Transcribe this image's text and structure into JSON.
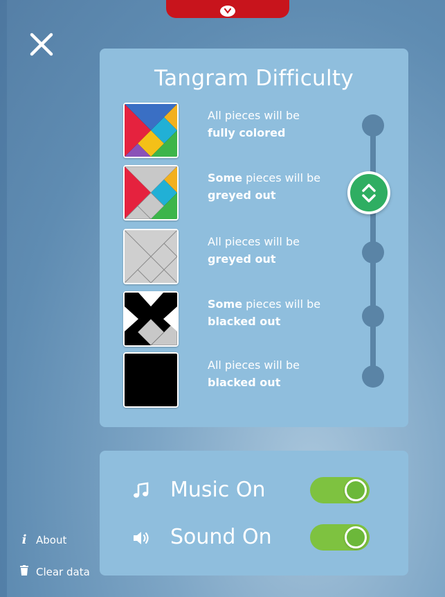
{
  "header": {
    "close_icon": "close-icon",
    "top_tab_icon": "chevron-down-icon",
    "accent": "#c8141c"
  },
  "difficulty": {
    "title": "Tangram Difficulty",
    "selected_index": 1,
    "options": [
      {
        "line1_pre": "",
        "line1_bold": "",
        "line1_post": "All pieces will be",
        "line2": "fully colored"
      },
      {
        "line1_pre": "",
        "line1_bold": "Some",
        "line1_post": " pieces will be",
        "line2": "greyed out"
      },
      {
        "line1_pre": "",
        "line1_bold": "",
        "line1_post": "All pieces will be",
        "line2": "greyed out"
      },
      {
        "line1_pre": "",
        "line1_bold": "Some",
        "line1_post": " pieces will be",
        "line2": "blacked out"
      },
      {
        "line1_pre": "",
        "line1_bold": "",
        "line1_post": "All pieces will be",
        "line2": "blacked out"
      }
    ]
  },
  "settings": {
    "music": {
      "label": "Music On",
      "icon": "music-note-icon",
      "on": true
    },
    "sound": {
      "label": "Sound On",
      "icon": "speaker-icon",
      "on": true
    },
    "toggle_color": "#7ec240"
  },
  "sidebar": {
    "about": {
      "label": "About",
      "icon": "info-icon"
    },
    "clear": {
      "label": "Clear data",
      "icon": "trash-icon"
    }
  }
}
